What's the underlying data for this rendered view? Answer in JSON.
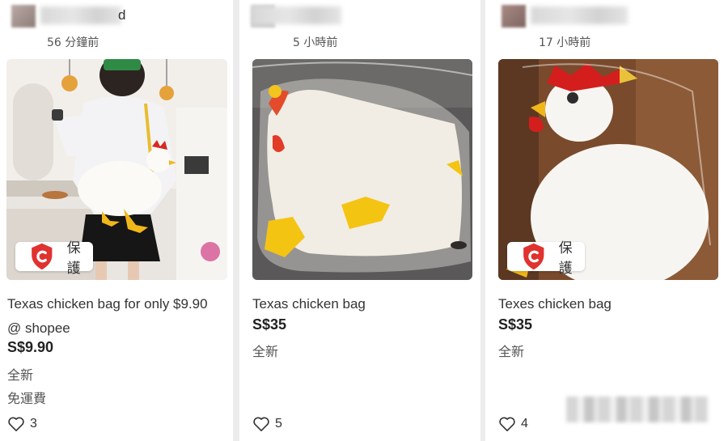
{
  "listings": [
    {
      "seller_name_suffix": "d",
      "time_ago": "56 分鐘前",
      "protection_label": "保護",
      "title_line1": "Texas chicken bag for only $9.90",
      "title_line2": "@ shopee",
      "price": "S$9.90",
      "condition": "全新",
      "shipping": "免運費",
      "likes": "3"
    },
    {
      "time_ago": "5 小時前",
      "title_line1": "Texas chicken bag",
      "price": "S$35",
      "condition": "全新",
      "likes": "5"
    },
    {
      "time_ago": "17 小時前",
      "protection_label": "保護",
      "title_line1": "Texes chicken bag",
      "price": "S$35",
      "condition": "全新",
      "likes": "4"
    }
  ],
  "colors": {
    "protection_red": "#e0322f",
    "background": "#ececec"
  },
  "icons": {
    "protection": "shield-check-icon",
    "like": "heart-outline-icon"
  }
}
